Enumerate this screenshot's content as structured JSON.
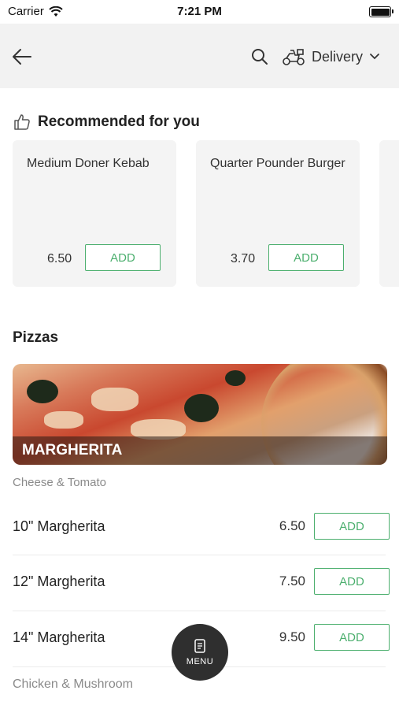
{
  "status": {
    "carrier": "Carrier",
    "time": "7:21 PM"
  },
  "nav": {
    "delivery_label": "Delivery"
  },
  "recommended": {
    "title": "Recommended for you",
    "items": [
      {
        "name": "Medium Doner Kebab",
        "price": "6.50",
        "add_label": "ADD"
      },
      {
        "name": "Quarter Pounder Burger",
        "price": "3.70",
        "add_label": "ADD"
      }
    ]
  },
  "pizzas": {
    "title": "Pizzas",
    "category": {
      "name": "MARGHERITA",
      "description": "Cheese & Tomato",
      "items": [
        {
          "name": "10\" Margherita",
          "price": "6.50",
          "add_label": "ADD"
        },
        {
          "name": "12\" Margherita",
          "price": "7.50",
          "add_label": "ADD"
        },
        {
          "name": "14\" Margherita",
          "price": "9.50",
          "add_label": "ADD"
        }
      ]
    },
    "next_category_description": "Chicken & Mushroom"
  },
  "menu_button": {
    "label": "MENU"
  },
  "colors": {
    "accent": "#4caf6e",
    "nav_bg": "#f2f2f2",
    "card_bg": "#f4f4f4",
    "fab_bg": "#2f2f2f"
  }
}
